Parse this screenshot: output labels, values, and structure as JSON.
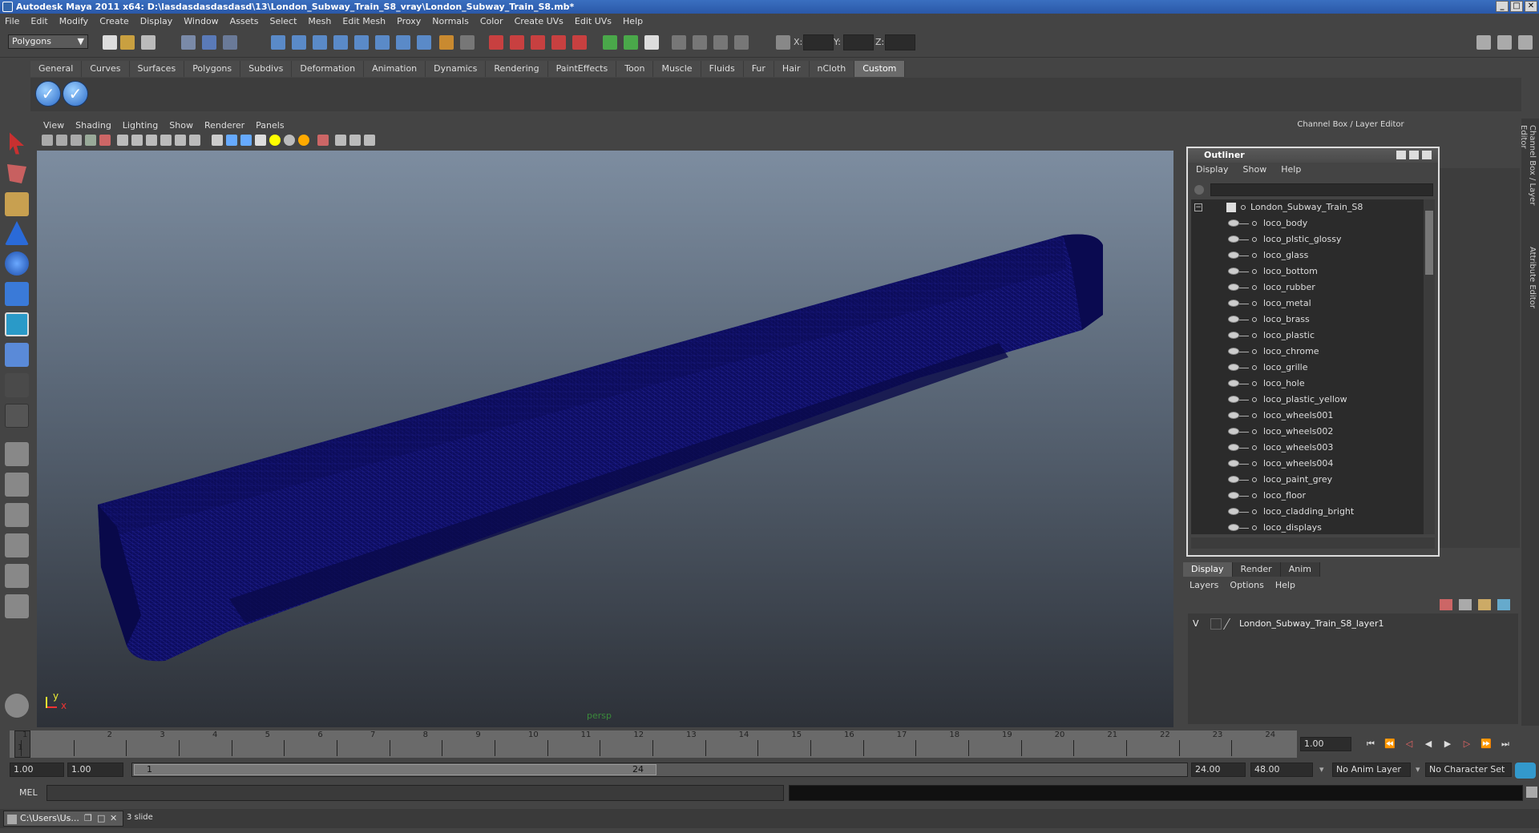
{
  "title": "Autodesk Maya 2011 x64: D:\\lasdasdasdasdasd\\13\\London_Subway_Train_S8_vray\\London_Subway_Train_S8.mb*",
  "menu": [
    "File",
    "Edit",
    "Modify",
    "Create",
    "Display",
    "Window",
    "Assets",
    "Select",
    "Mesh",
    "Edit Mesh",
    "Proxy",
    "Normals",
    "Color",
    "Create UVs",
    "Edit UVs",
    "Help"
  ],
  "mode": "Polygons",
  "coords": {
    "x": "X:",
    "y": "Y:",
    "z": "Z:"
  },
  "shelf_tabs": [
    "General",
    "Curves",
    "Surfaces",
    "Polygons",
    "Subdivs",
    "Deformation",
    "Animation",
    "Dynamics",
    "Rendering",
    "PaintEffects",
    "Toon",
    "Muscle",
    "Fluids",
    "Fur",
    "Hair",
    "nCloth",
    "Custom"
  ],
  "shelf_active": "Custom",
  "viewport": {
    "menu": [
      "View",
      "Shading",
      "Lighting",
      "Show",
      "Renderer",
      "Panels"
    ],
    "camera": "persp",
    "axis_y": "y",
    "axis_x": "x",
    "wire_color": "#10106a"
  },
  "panel_header": "Channel Box / Layer Editor",
  "side_tabs": [
    "Channel Box / Layer Editor",
    "Attribute Editor"
  ],
  "outliner": {
    "title": "Outliner",
    "menu": [
      "Display",
      "Show",
      "Help"
    ],
    "root": "London_Subway_Train_S8",
    "items": [
      "loco_body",
      "loco_plstic_glossy",
      "loco_glass",
      "loco_bottom",
      "loco_rubber",
      "loco_metal",
      "loco_brass",
      "loco_plastic",
      "loco_chrome",
      "loco_grille",
      "loco_hole",
      "loco_plastic_yellow",
      "loco_wheels001",
      "loco_wheels002",
      "loco_wheels003",
      "loco_wheels004",
      "loco_paint_grey",
      "loco_floor",
      "loco_cladding_bright",
      "loco_displays"
    ]
  },
  "layer_editor": {
    "tabs": [
      "Display",
      "Render",
      "Anim"
    ],
    "active": "Display",
    "menu": [
      "Layers",
      "Options",
      "Help"
    ],
    "layer": {
      "vis": "V",
      "name": "London_Subway_Train_S8_layer1"
    }
  },
  "timeline": {
    "ticks": [
      "1",
      "2",
      "3",
      "4",
      "5",
      "6",
      "7",
      "8",
      "9",
      "10",
      "11",
      "12",
      "13",
      "14",
      "15",
      "16",
      "17",
      "18",
      "19",
      "20",
      "21",
      "22",
      "23",
      "24"
    ],
    "current": "1",
    "current_field": "1.00"
  },
  "range": {
    "start": "1.00",
    "play_start": "1.00",
    "slider_start": "1",
    "slider_end": "24",
    "play_end": "24.00",
    "end": "48.00",
    "anim_layer": "No Anim Layer",
    "char_set": "No Character Set"
  },
  "mel": {
    "label": "MEL"
  },
  "taskbar": {
    "item": "C:\\Users\\Us...",
    "slide": "3 slide"
  }
}
